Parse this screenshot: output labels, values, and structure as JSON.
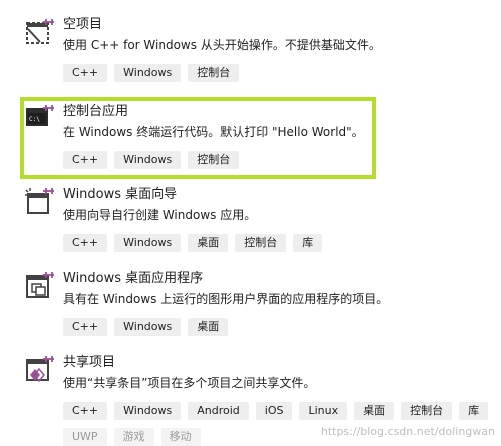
{
  "templates": [
    {
      "title": "空项目",
      "desc": "使用 C++ for Windows 从头开始操作。不提供基础文件。",
      "tags": [
        "C++",
        "Windows",
        "控制台"
      ],
      "icon": "empty-project-icon"
    },
    {
      "title": "控制台应用",
      "desc": "在 Windows 终端运行代码。默认打印 \"Hello World\"。",
      "tags": [
        "C++",
        "Windows",
        "控制台"
      ],
      "icon": "console-app-icon"
    },
    {
      "title": "Windows 桌面向导",
      "desc": "使用向导自行创建 Windows 应用。",
      "tags": [
        "C++",
        "Windows",
        "桌面",
        "控制台",
        "库"
      ],
      "icon": "desktop-wizard-icon"
    },
    {
      "title": "Windows 桌面应用程序",
      "desc": "具有在 Windows 上运行的图形用户界面的应用程序的项目。",
      "tags": [
        "C++",
        "Windows",
        "桌面"
      ],
      "icon": "desktop-app-icon"
    },
    {
      "title": "共享项目",
      "desc": "使用“共享条目”项目在多个项目之间共享文件。",
      "tags": [
        "C++",
        "Windows",
        "Android",
        "iOS",
        "Linux",
        "桌面",
        "控制台",
        "库"
      ],
      "tags2": [
        "UWP",
        "游戏",
        "移动"
      ],
      "icon": "shared-project-icon"
    }
  ],
  "watermark": "https://blog.csdn.net/dolingwan",
  "colors": {
    "highlight": "#b5de2c",
    "icon_purple": "#9b4f96",
    "tag_bg": "#eeeeee"
  }
}
